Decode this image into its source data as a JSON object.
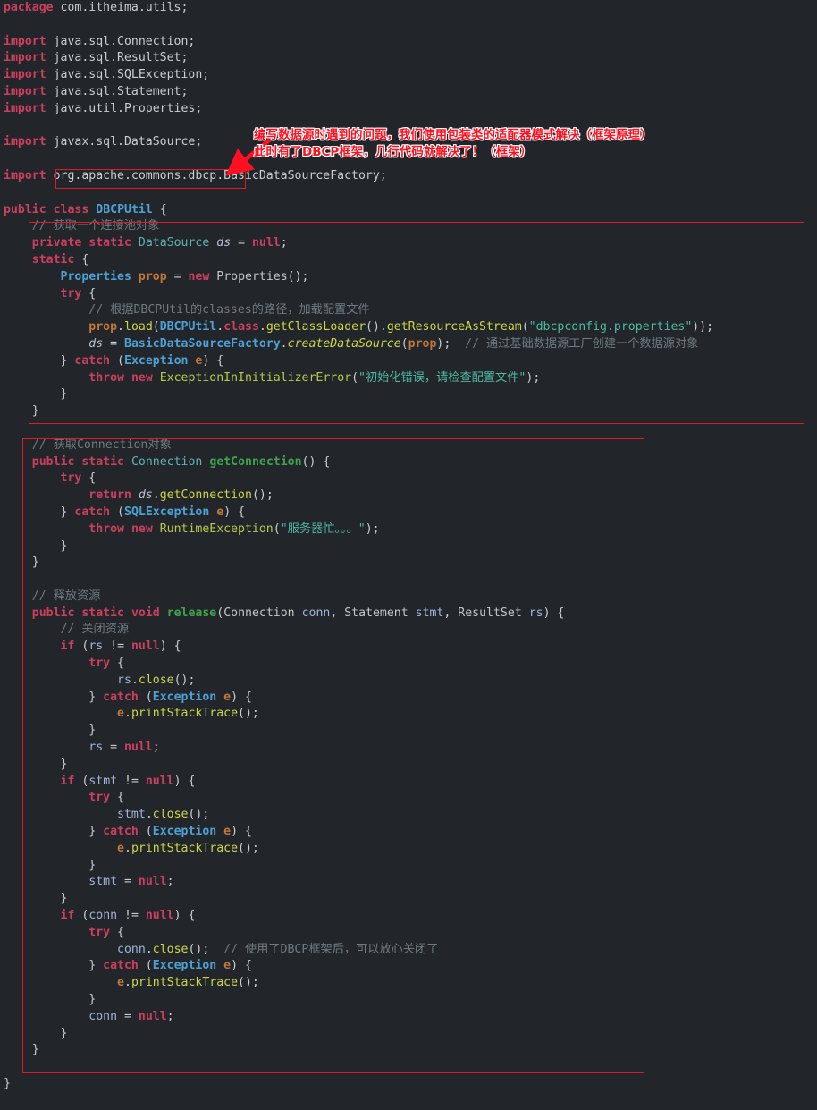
{
  "editor": {
    "background_color": "#22262a",
    "annotation_color": "#e01b24",
    "language": "java",
    "file_class": "DBCPUtil"
  },
  "annotation": {
    "line1": "编写数据源时遇到的问题，我们使用包装类的适配器模式解决（框架原理）",
    "line2": "此时有了DBCP框架，几行代码就解决了！（框架）",
    "arrow": "arrow-down-left",
    "highlighted_token": "org.apache.commons.dbcp"
  },
  "code": {
    "lines": [
      [
        {
          "t": "package",
          "c": "kw"
        },
        {
          "t": " com.itheima.utils;",
          "c": "pkg"
        }
      ],
      [],
      [
        {
          "t": "import",
          "c": "kw"
        },
        {
          "t": " java.sql.Connection;",
          "c": "pkg"
        }
      ],
      [
        {
          "t": "import",
          "c": "kw"
        },
        {
          "t": " java.sql.ResultSet;",
          "c": "pkg"
        }
      ],
      [
        {
          "t": "import",
          "c": "kw"
        },
        {
          "t": " java.sql.SQLException;",
          "c": "pkg"
        }
      ],
      [
        {
          "t": "import",
          "c": "kw"
        },
        {
          "t": " java.sql.Statement;",
          "c": "pkg"
        }
      ],
      [
        {
          "t": "import",
          "c": "kw"
        },
        {
          "t": " java.util.Properties;",
          "c": "pkg"
        }
      ],
      [],
      [
        {
          "t": "import",
          "c": "kw"
        },
        {
          "t": " javax.sql.DataSource;",
          "c": "pkg"
        }
      ],
      [],
      [
        {
          "t": "import",
          "c": "kw"
        },
        {
          "t": " org.apache.commons.dbcp.BasicDataSourceFactory;",
          "c": "pkg"
        }
      ],
      [],
      [
        {
          "t": "public",
          "c": "kw"
        },
        {
          "t": " ",
          "c": "pun"
        },
        {
          "t": "class",
          "c": "kw"
        },
        {
          "t": " ",
          "c": "pun"
        },
        {
          "t": "DBCPUtil",
          "c": "cls"
        },
        {
          "t": " {",
          "c": "pun"
        }
      ],
      [
        {
          "t": "    // 获取一个连接池对象",
          "c": "cmt"
        }
      ],
      [
        {
          "t": "    ",
          "c": "pun"
        },
        {
          "t": "private",
          "c": "kw"
        },
        {
          "t": " ",
          "c": "pun"
        },
        {
          "t": "static",
          "c": "kw"
        },
        {
          "t": " ",
          "c": "pun"
        },
        {
          "t": "DataSource",
          "c": "cls2"
        },
        {
          "t": " ",
          "c": "pun"
        },
        {
          "t": "ds",
          "c": "vari"
        },
        {
          "t": " = ",
          "c": "pun"
        },
        {
          "t": "null",
          "c": "nul"
        },
        {
          "t": ";",
          "c": "pun"
        }
      ],
      [
        {
          "t": "    ",
          "c": "pun"
        },
        {
          "t": "static",
          "c": "kw"
        },
        {
          "t": " {",
          "c": "pun"
        }
      ],
      [
        {
          "t": "        ",
          "c": "pun"
        },
        {
          "t": "Properties",
          "c": "cls"
        },
        {
          "t": " ",
          "c": "pun"
        },
        {
          "t": "prop",
          "c": "fld"
        },
        {
          "t": " = ",
          "c": "pun"
        },
        {
          "t": "new",
          "c": "kw"
        },
        {
          "t": " ",
          "c": "pun"
        },
        {
          "t": "Properties",
          "c": "typ"
        },
        {
          "t": "();",
          "c": "pun"
        }
      ],
      [
        {
          "t": "        ",
          "c": "pun"
        },
        {
          "t": "try",
          "c": "kw"
        },
        {
          "t": " {",
          "c": "pun"
        }
      ],
      [
        {
          "t": "            // 根据DBCPUtil的classes的路径，加载配置文件",
          "c": "cmt"
        }
      ],
      [
        {
          "t": "            ",
          "c": "pun"
        },
        {
          "t": "prop",
          "c": "fld"
        },
        {
          "t": ".",
          "c": "pun"
        },
        {
          "t": "load",
          "c": "mth"
        },
        {
          "t": "(",
          "c": "pun"
        },
        {
          "t": "DBCPUtil",
          "c": "cls"
        },
        {
          "t": ".",
          "c": "pun"
        },
        {
          "t": "class",
          "c": "kw"
        },
        {
          "t": ".",
          "c": "pun"
        },
        {
          "t": "getClassLoader",
          "c": "mth"
        },
        {
          "t": "().",
          "c": "pun"
        },
        {
          "t": "getResourceAsStream",
          "c": "mth"
        },
        {
          "t": "(",
          "c": "pun"
        },
        {
          "t": "\"dbcpconfig.properties\"",
          "c": "str"
        },
        {
          "t": "));",
          "c": "pun"
        }
      ],
      [
        {
          "t": "            ",
          "c": "pun"
        },
        {
          "t": "ds",
          "c": "vari"
        },
        {
          "t": " = ",
          "c": "pun"
        },
        {
          "t": "BasicDataSourceFactory",
          "c": "cls"
        },
        {
          "t": ".",
          "c": "pun"
        },
        {
          "t": "createDataSource",
          "c": "mthi"
        },
        {
          "t": "(",
          "c": "pun"
        },
        {
          "t": "prop",
          "c": "fld"
        },
        {
          "t": ");",
          "c": "pun"
        },
        {
          "t": "  // 通过基础数据源工厂创建一个数据源对象",
          "c": "cmt"
        }
      ],
      [
        {
          "t": "        } ",
          "c": "pun"
        },
        {
          "t": "catch",
          "c": "kw"
        },
        {
          "t": " (",
          "c": "pun"
        },
        {
          "t": "Exception",
          "c": "cls"
        },
        {
          "t": " ",
          "c": "pun"
        },
        {
          "t": "e",
          "c": "fld"
        },
        {
          "t": ") {",
          "c": "pun"
        }
      ],
      [
        {
          "t": "            ",
          "c": "pun"
        },
        {
          "t": "throw",
          "c": "kw"
        },
        {
          "t": " ",
          "c": "pun"
        },
        {
          "t": "new",
          "c": "kw"
        },
        {
          "t": " ",
          "c": "pun"
        },
        {
          "t": "ExceptionInInitializerError",
          "c": "strg"
        },
        {
          "t": "(",
          "c": "pun"
        },
        {
          "t": "\"初始化错误，请检查配置文件\"",
          "c": "str"
        },
        {
          "t": ");",
          "c": "pun"
        }
      ],
      [
        {
          "t": "        }",
          "c": "pun"
        }
      ],
      [
        {
          "t": "    }",
          "c": "pun"
        }
      ],
      [],
      [
        {
          "t": "    // 获取Connection对象",
          "c": "cmt"
        }
      ],
      [
        {
          "t": "    ",
          "c": "pun"
        },
        {
          "t": "public",
          "c": "kw"
        },
        {
          "t": " ",
          "c": "pun"
        },
        {
          "t": "static",
          "c": "kw"
        },
        {
          "t": " ",
          "c": "pun"
        },
        {
          "t": "Connection",
          "c": "cls2"
        },
        {
          "t": " ",
          "c": "pun"
        },
        {
          "t": "getConnection",
          "c": "mthg"
        },
        {
          "t": "() {",
          "c": "pun"
        }
      ],
      [
        {
          "t": "        ",
          "c": "pun"
        },
        {
          "t": "try",
          "c": "kw"
        },
        {
          "t": " {",
          "c": "pun"
        }
      ],
      [
        {
          "t": "            ",
          "c": "pun"
        },
        {
          "t": "return",
          "c": "kw"
        },
        {
          "t": " ",
          "c": "pun"
        },
        {
          "t": "ds",
          "c": "vari"
        },
        {
          "t": ".",
          "c": "pun"
        },
        {
          "t": "getConnection",
          "c": "mth"
        },
        {
          "t": "();",
          "c": "pun"
        }
      ],
      [
        {
          "t": "        } ",
          "c": "pun"
        },
        {
          "t": "catch",
          "c": "kw"
        },
        {
          "t": " (",
          "c": "pun"
        },
        {
          "t": "SQLException",
          "c": "cls"
        },
        {
          "t": " ",
          "c": "pun"
        },
        {
          "t": "e",
          "c": "fld"
        },
        {
          "t": ") {",
          "c": "pun"
        }
      ],
      [
        {
          "t": "            ",
          "c": "pun"
        },
        {
          "t": "throw",
          "c": "kw"
        },
        {
          "t": " ",
          "c": "pun"
        },
        {
          "t": "new",
          "c": "kw"
        },
        {
          "t": " ",
          "c": "pun"
        },
        {
          "t": "RuntimeException",
          "c": "strg"
        },
        {
          "t": "(",
          "c": "pun"
        },
        {
          "t": "\"服务器忙。。。\"",
          "c": "str"
        },
        {
          "t": ");",
          "c": "pun"
        }
      ],
      [
        {
          "t": "        }",
          "c": "pun"
        }
      ],
      [
        {
          "t": "    }",
          "c": "pun"
        }
      ],
      [],
      [
        {
          "t": "    // 释放资源",
          "c": "cmt"
        }
      ],
      [
        {
          "t": "    ",
          "c": "pun"
        },
        {
          "t": "public",
          "c": "kw"
        },
        {
          "t": " ",
          "c": "pun"
        },
        {
          "t": "static",
          "c": "kw"
        },
        {
          "t": " ",
          "c": "pun"
        },
        {
          "t": "void",
          "c": "kw"
        },
        {
          "t": " ",
          "c": "pun"
        },
        {
          "t": "release",
          "c": "mthg"
        },
        {
          "t": "(",
          "c": "pun"
        },
        {
          "t": "Connection",
          "c": "typ"
        },
        {
          "t": " ",
          "c": "pun"
        },
        {
          "t": "conn",
          "c": "var"
        },
        {
          "t": ", ",
          "c": "pun"
        },
        {
          "t": "Statement",
          "c": "typ"
        },
        {
          "t": " ",
          "c": "pun"
        },
        {
          "t": "stmt",
          "c": "var"
        },
        {
          "t": ", ",
          "c": "pun"
        },
        {
          "t": "ResultSet",
          "c": "typ"
        },
        {
          "t": " ",
          "c": "pun"
        },
        {
          "t": "rs",
          "c": "var"
        },
        {
          "t": ") {",
          "c": "pun"
        }
      ],
      [
        {
          "t": "        // 关闭资源",
          "c": "cmt"
        }
      ],
      [
        {
          "t": "        ",
          "c": "pun"
        },
        {
          "t": "if",
          "c": "kw"
        },
        {
          "t": " (",
          "c": "pun"
        },
        {
          "t": "rs",
          "c": "var"
        },
        {
          "t": " != ",
          "c": "pun"
        },
        {
          "t": "null",
          "c": "nul"
        },
        {
          "t": ") {",
          "c": "pun"
        }
      ],
      [
        {
          "t": "            ",
          "c": "pun"
        },
        {
          "t": "try",
          "c": "kw"
        },
        {
          "t": " {",
          "c": "pun"
        }
      ],
      [
        {
          "t": "                ",
          "c": "pun"
        },
        {
          "t": "rs",
          "c": "var"
        },
        {
          "t": ".",
          "c": "pun"
        },
        {
          "t": "close",
          "c": "mth"
        },
        {
          "t": "();",
          "c": "pun"
        }
      ],
      [
        {
          "t": "            } ",
          "c": "pun"
        },
        {
          "t": "catch",
          "c": "kw"
        },
        {
          "t": " (",
          "c": "pun"
        },
        {
          "t": "Exception",
          "c": "cls"
        },
        {
          "t": " ",
          "c": "pun"
        },
        {
          "t": "e",
          "c": "fld"
        },
        {
          "t": ") {",
          "c": "pun"
        }
      ],
      [
        {
          "t": "                ",
          "c": "pun"
        },
        {
          "t": "e",
          "c": "fld"
        },
        {
          "t": ".",
          "c": "pun"
        },
        {
          "t": "printStackTrace",
          "c": "mth"
        },
        {
          "t": "();",
          "c": "pun"
        }
      ],
      [
        {
          "t": "            }",
          "c": "pun"
        }
      ],
      [
        {
          "t": "            ",
          "c": "pun"
        },
        {
          "t": "rs",
          "c": "var"
        },
        {
          "t": " = ",
          "c": "pun"
        },
        {
          "t": "null",
          "c": "nul"
        },
        {
          "t": ";",
          "c": "pun"
        }
      ],
      [
        {
          "t": "        }",
          "c": "pun"
        }
      ],
      [
        {
          "t": "        ",
          "c": "pun"
        },
        {
          "t": "if",
          "c": "kw"
        },
        {
          "t": " (",
          "c": "pun"
        },
        {
          "t": "stmt",
          "c": "var"
        },
        {
          "t": " != ",
          "c": "pun"
        },
        {
          "t": "null",
          "c": "nul"
        },
        {
          "t": ") {",
          "c": "pun"
        }
      ],
      [
        {
          "t": "            ",
          "c": "pun"
        },
        {
          "t": "try",
          "c": "kw"
        },
        {
          "t": " {",
          "c": "pun"
        }
      ],
      [
        {
          "t": "                ",
          "c": "pun"
        },
        {
          "t": "stmt",
          "c": "var"
        },
        {
          "t": ".",
          "c": "pun"
        },
        {
          "t": "close",
          "c": "mth"
        },
        {
          "t": "();",
          "c": "pun"
        }
      ],
      [
        {
          "t": "            } ",
          "c": "pun"
        },
        {
          "t": "catch",
          "c": "kw"
        },
        {
          "t": " (",
          "c": "pun"
        },
        {
          "t": "Exception",
          "c": "cls"
        },
        {
          "t": " ",
          "c": "pun"
        },
        {
          "t": "e",
          "c": "fld"
        },
        {
          "t": ") {",
          "c": "pun"
        }
      ],
      [
        {
          "t": "                ",
          "c": "pun"
        },
        {
          "t": "e",
          "c": "fld"
        },
        {
          "t": ".",
          "c": "pun"
        },
        {
          "t": "printStackTrace",
          "c": "mth"
        },
        {
          "t": "();",
          "c": "pun"
        }
      ],
      [
        {
          "t": "            }",
          "c": "pun"
        }
      ],
      [
        {
          "t": "            ",
          "c": "pun"
        },
        {
          "t": "stmt",
          "c": "var"
        },
        {
          "t": " = ",
          "c": "pun"
        },
        {
          "t": "null",
          "c": "nul"
        },
        {
          "t": ";",
          "c": "pun"
        }
      ],
      [
        {
          "t": "        }",
          "c": "pun"
        }
      ],
      [
        {
          "t": "        ",
          "c": "pun"
        },
        {
          "t": "if",
          "c": "kw"
        },
        {
          "t": " (",
          "c": "pun"
        },
        {
          "t": "conn",
          "c": "var"
        },
        {
          "t": " != ",
          "c": "pun"
        },
        {
          "t": "null",
          "c": "nul"
        },
        {
          "t": ") {",
          "c": "pun"
        }
      ],
      [
        {
          "t": "            ",
          "c": "pun"
        },
        {
          "t": "try",
          "c": "kw"
        },
        {
          "t": " {",
          "c": "pun"
        }
      ],
      [
        {
          "t": "                ",
          "c": "pun"
        },
        {
          "t": "conn",
          "c": "var"
        },
        {
          "t": ".",
          "c": "pun"
        },
        {
          "t": "close",
          "c": "mth"
        },
        {
          "t": "();",
          "c": "pun"
        },
        {
          "t": "  // 使用了DBCP框架后，可以放心关闭了",
          "c": "cmt"
        }
      ],
      [
        {
          "t": "            } ",
          "c": "pun"
        },
        {
          "t": "catch",
          "c": "kw"
        },
        {
          "t": " (",
          "c": "pun"
        },
        {
          "t": "Exception",
          "c": "cls"
        },
        {
          "t": " ",
          "c": "pun"
        },
        {
          "t": "e",
          "c": "fld"
        },
        {
          "t": ") {",
          "c": "pun"
        }
      ],
      [
        {
          "t": "                ",
          "c": "pun"
        },
        {
          "t": "e",
          "c": "fld"
        },
        {
          "t": ".",
          "c": "pun"
        },
        {
          "t": "printStackTrace",
          "c": "mth"
        },
        {
          "t": "();",
          "c": "pun"
        }
      ],
      [
        {
          "t": "            }",
          "c": "pun"
        }
      ],
      [
        {
          "t": "            ",
          "c": "pun"
        },
        {
          "t": "conn",
          "c": "var"
        },
        {
          "t": " = ",
          "c": "pun"
        },
        {
          "t": "null",
          "c": "nul"
        },
        {
          "t": ";",
          "c": "pun"
        }
      ],
      [
        {
          "t": "        }",
          "c": "pun"
        }
      ],
      [
        {
          "t": "    }",
          "c": "pun"
        }
      ],
      [],
      [
        {
          "t": "}",
          "c": "pun"
        }
      ]
    ]
  }
}
